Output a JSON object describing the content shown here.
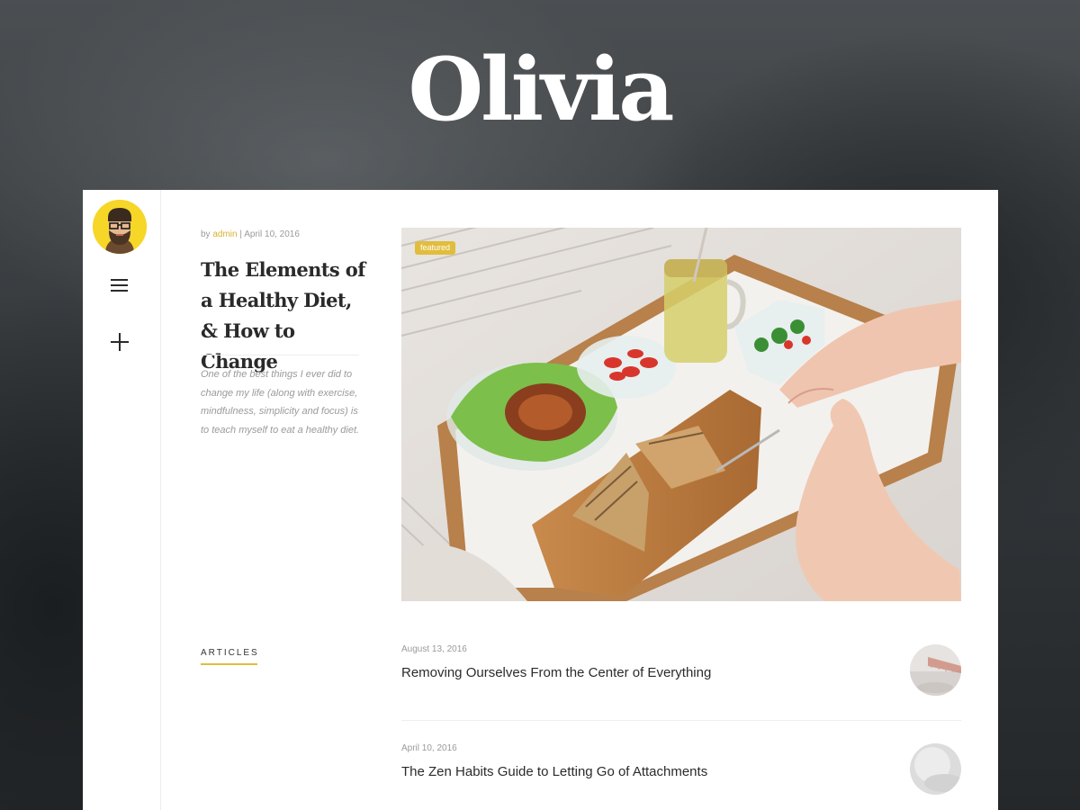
{
  "site": {
    "brand": "Olivia"
  },
  "rail": {
    "avatar_icon": "bearded-man-avatar-icon",
    "menu_icon": "hamburger-menu-icon",
    "add_icon": "plus-icon"
  },
  "featured_post": {
    "byline_prefix": "by",
    "author": "admin",
    "separator": "|",
    "date": "April 10, 2016",
    "title": "The Elements of a Healthy Diet, & How to Change",
    "excerpt": "One of the best things I ever did to change my life (along with exercise, mindfulness, simplicity and focus) is to teach myself to eat a healthy diet.",
    "badge": "featured",
    "image_icon": "breakfast-tray-photo"
  },
  "articles_section": {
    "label": "ARTICLES",
    "items": [
      {
        "date": "August 13, 2016",
        "title": "Removing Ourselves From the Center of Everything",
        "thumb_icon": "bridge-photo-thumbnail"
      },
      {
        "date": "April 10, 2016",
        "title": "The Zen Habits Guide to Letting Go of Attachments",
        "thumb_icon": "misty-photo-thumbnail"
      }
    ]
  },
  "colors": {
    "accent": "#e1bd3c",
    "text_dark": "#2a2a2a",
    "text_muted": "#9a9a9a",
    "background": "#3a3d3f"
  }
}
